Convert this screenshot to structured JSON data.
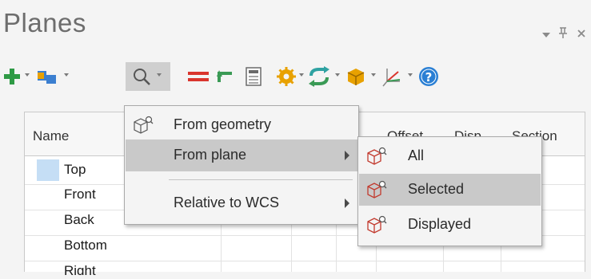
{
  "panel": {
    "title": "Planes"
  },
  "title_controls": {
    "dropdown_icon": "chevron-down-icon",
    "pin_icon": "pin-icon",
    "close_icon": "close-icon"
  },
  "toolbar": {
    "tools": [
      "add-icon",
      "flag-icon",
      "search-icon",
      "equals-icon",
      "undo-icon",
      "calculator-icon",
      "gear-icon",
      "sync-icon",
      "box-icon",
      "axes-icon",
      "help-icon"
    ]
  },
  "table": {
    "headers": [
      "Name",
      "Offset",
      "Disp",
      "Section"
    ],
    "rows": [
      "Top",
      "Front",
      "Back",
      "Bottom",
      "Right"
    ]
  },
  "menu": {
    "items": [
      {
        "label": "From geometry"
      },
      {
        "label": "From plane"
      },
      {
        "label": "Relative to WCS"
      }
    ]
  },
  "submenu": {
    "items": [
      {
        "label": "All"
      },
      {
        "label": "Selected"
      },
      {
        "label": "Displayed"
      }
    ]
  },
  "colors": {
    "accent_green": "#2e9a45",
    "accent_red": "#d9352d",
    "help_blue": "#2a7fd4",
    "highlight": "#c9c9c9"
  }
}
